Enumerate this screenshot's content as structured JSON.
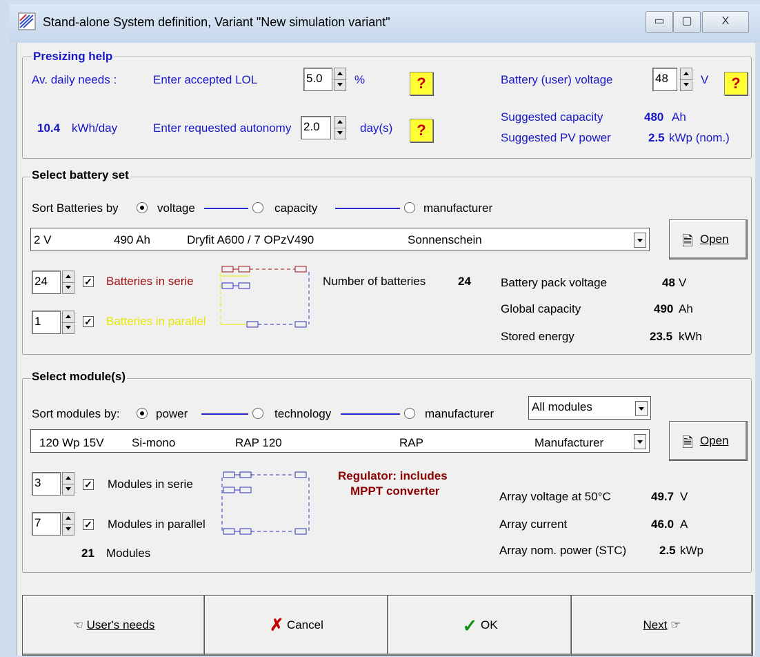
{
  "window": {
    "title": "Stand-alone System definition, Variant  \"New simulation variant\"",
    "minimize": "▭",
    "maximize": "▢",
    "close": "X"
  },
  "presizing": {
    "title": "Presizing help",
    "daily_label": "Av. daily needs :",
    "daily_value": "10.4",
    "daily_unit": "kWh/day",
    "lol_label": "Enter accepted LOL",
    "lol_value": "5.0",
    "lol_unit": "%",
    "autonomy_label": "Enter requested autonomy",
    "autonomy_value": "2.0",
    "autonomy_unit": "day(s)",
    "voltage_label": "Battery (user) voltage",
    "voltage_value": "48",
    "voltage_unit": "V",
    "capacity_label": "Suggested capacity",
    "capacity_value": "480",
    "capacity_unit": "Ah",
    "pv_label": "Suggested PV power",
    "pv_value": "2.5",
    "pv_unit": "kWp (nom.)",
    "help_symbol": "?"
  },
  "battery": {
    "title": "Select battery set",
    "sort_label": "Sort Batteries by",
    "sort_options": [
      "voltage",
      "capacity",
      "manufacturer"
    ],
    "sort_selected": "voltage",
    "selected": {
      "voltage": "2 V",
      "capacity": "490 Ah",
      "model": "Dryfit A600 / 7 OPzV490",
      "manufacturer": "Sonnenschein"
    },
    "open_label": "Open",
    "serie_value": "24",
    "serie_label": "Batteries in serie",
    "parallel_value": "1",
    "parallel_label": "Batteries in parallel",
    "number_label": "Number of batteries",
    "number_value": "24",
    "pack_voltage_label": "Battery pack voltage",
    "pack_voltage_value": "48",
    "pack_voltage_unit": "V",
    "global_capacity_label": "Global capacity",
    "global_capacity_value": "490",
    "global_capacity_unit": "Ah",
    "stored_label": "Stored energy",
    "stored_value": "23.5",
    "stored_unit": "kWh"
  },
  "modules": {
    "title": "Select module(s)",
    "sort_label": "Sort modules by:",
    "sort_options": [
      "power",
      "technology",
      "manufacturer"
    ],
    "sort_selected": "power",
    "filter": "All modules",
    "selected": {
      "power": "120 Wp 15V",
      "tech": "Si-mono",
      "model": "RAP 120",
      "manufacturer": "RAP",
      "source": "Manufacturer"
    },
    "open_label": "Open",
    "serie_value": "3",
    "serie_label": "Modules in serie",
    "parallel_value": "7",
    "parallel_label": "Modules in parallel",
    "total_value": "21",
    "total_label": "Modules",
    "regulator_line1": "Regulator: includes",
    "regulator_line2": "MPPT converter",
    "array_voltage_label": "Array voltage at 50°C",
    "array_voltage_value": "49.7",
    "array_voltage_unit": "V",
    "array_current_label": "Array current",
    "array_current_value": "46.0",
    "array_current_unit": "A",
    "array_power_label": "Array nom. power (STC)",
    "array_power_value": "2.5",
    "array_power_unit": "kWp"
  },
  "buttons": {
    "users_needs": "User's needs",
    "cancel": "Cancel",
    "ok": "OK",
    "next": "Next"
  },
  "colors": {
    "label_blue": "#1818c8",
    "serie_red": "#a01010",
    "parallel_yellow": "#e8e800",
    "regulator_red": "#8b0000",
    "help_yellow": "#ffff33"
  }
}
